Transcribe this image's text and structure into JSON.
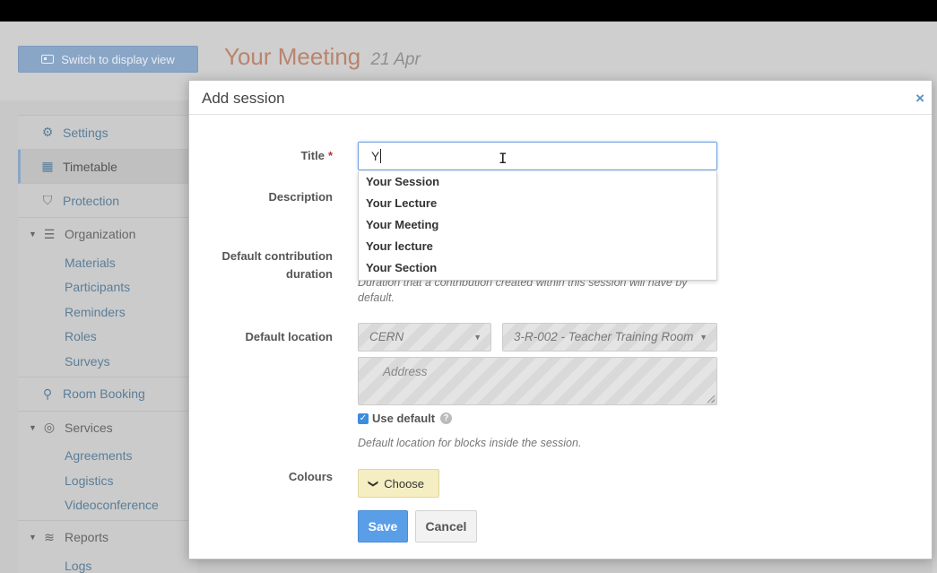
{
  "header": {
    "switch_view_label": "Switch to display view",
    "event_title": "Your Meeting",
    "event_date": "21 Apr"
  },
  "sidebar": {
    "items": [
      {
        "label": "Settings",
        "icon": "gear-icon"
      },
      {
        "label": "Timetable",
        "icon": "calendar-icon",
        "active": true
      },
      {
        "label": "Protection",
        "icon": "shield-icon"
      }
    ],
    "organization": {
      "label": "Organization",
      "icon": "list-icon",
      "children": [
        "Materials",
        "Participants",
        "Reminders",
        "Roles",
        "Surveys"
      ]
    },
    "room_booking": {
      "label": "Room Booking",
      "icon": "map-marker-icon"
    },
    "services": {
      "label": "Services",
      "icon": "broadcast-icon",
      "children": [
        "Agreements",
        "Logistics",
        "Videoconference"
      ]
    },
    "reports": {
      "label": "Reports",
      "icon": "stack-icon",
      "children": [
        "Logs"
      ]
    }
  },
  "modal": {
    "title": "Add session",
    "close_icon": "×",
    "fields": {
      "title_label": "Title",
      "title_value": "Y",
      "description_label": "Description",
      "duration_label_1": "Default contribution",
      "duration_label_2": "duration",
      "duration_help": "Duration that a contribution created within this session will have by default.",
      "location_label": "Default location",
      "venue_value": "CERN",
      "room_value": "3-R-002 - Teacher Training Room",
      "address_placeholder": "Address",
      "use_default_label": "Use default",
      "location_help": "Default location for blocks inside the session.",
      "colours_label": "Colours",
      "choose_label": "Choose"
    },
    "suggestions": [
      "Your Session",
      "Your Lecture",
      "Your Meeting",
      "Your lecture",
      "Your Section"
    ],
    "buttons": {
      "save": "Save",
      "cancel": "Cancel"
    }
  },
  "colors": {
    "accent": "#5b9ee8",
    "title": "#b9846d",
    "link": "#5a7e99",
    "colours_button": "#f5eec2"
  }
}
